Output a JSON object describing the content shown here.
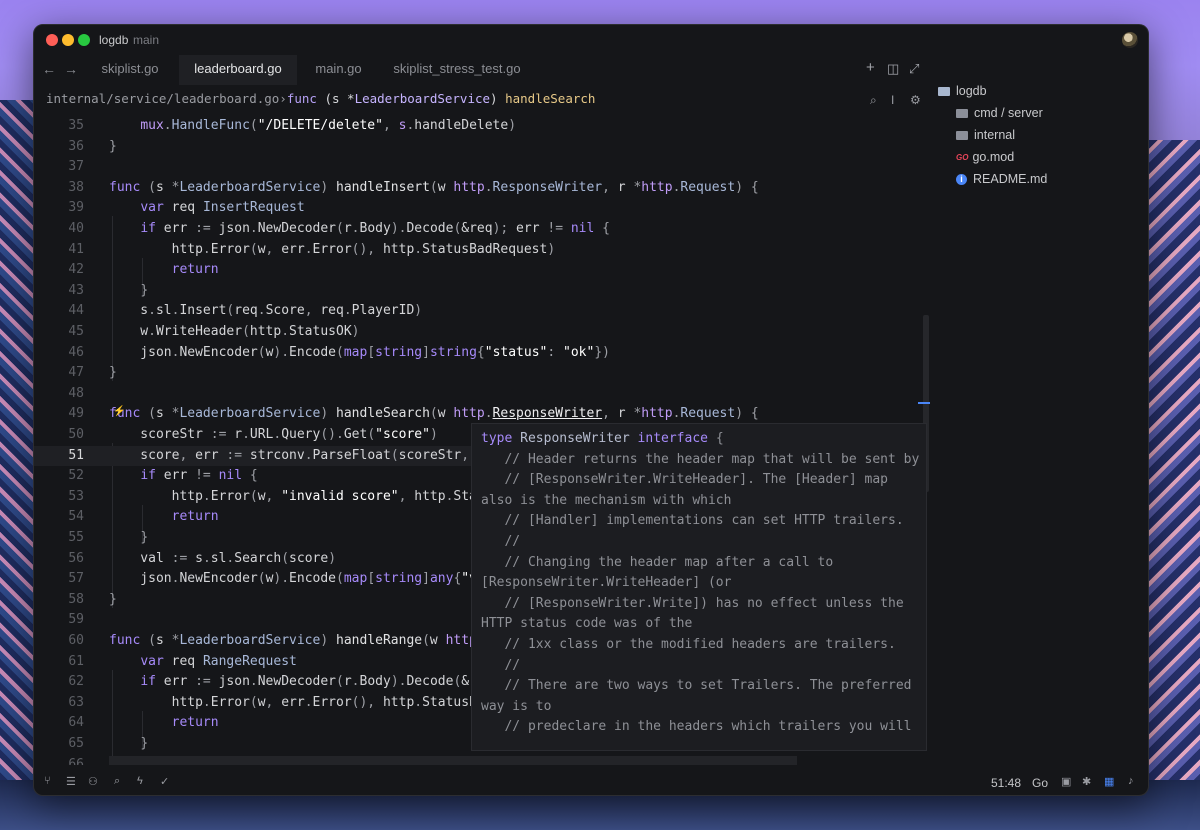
{
  "window": {
    "project": "logdb",
    "branch": "main"
  },
  "nav": {
    "back": "←",
    "forward": "→"
  },
  "tabs": [
    {
      "label": "skiplist.go",
      "active": false
    },
    {
      "label": "leaderboard.go",
      "active": true
    },
    {
      "label": "main.go",
      "active": false
    },
    {
      "label": "skiplist_stress_test.go",
      "active": false
    }
  ],
  "tab_actions": {
    "new": "+",
    "split": "◫",
    "zoom": "⤢"
  },
  "breadcrumb": {
    "path": "internal/service/leaderboard.go",
    "sep": "›",
    "func": "func",
    "recv_open": " (s *",
    "recv_type": "LeaderboardService",
    "recv_close": ") ",
    "name": "handleSearch"
  },
  "breadcrumb_tools": {
    "search": "⌕",
    "cursor": "I",
    "settings": "⚙"
  },
  "line_numbers": [
    "35",
    "36",
    "37",
    "38",
    "39",
    "40",
    "41",
    "42",
    "43",
    "44",
    "45",
    "46",
    "47",
    "48",
    "49",
    "50",
    "51",
    "52",
    "53",
    "54",
    "55",
    "56",
    "57",
    "58",
    "59",
    "60",
    "61",
    "62",
    "63",
    "64",
    "65",
    "66"
  ],
  "current_line": "51",
  "gutter_marker": "⚡",
  "tooltip": [
    "type ResponseWriter interface {",
    "   // Header returns the header map that will be sent by",
    "   // [ResponseWriter.WriteHeader]. The [Header] map",
    "also is the mechanism with which",
    "   // [Handler] implementations can set HTTP trailers.",
    "   //",
    "   // Changing the header map after a call to",
    "[ResponseWriter.WriteHeader] (or",
    "   // [ResponseWriter.Write]) has no effect unless the",
    "HTTP status code was of the",
    "   // 1xx class or the modified headers are trailers.",
    "   //",
    "   // There are two ways to set Trailers. The preferred",
    "way is to",
    "   // predeclare in the headers which trailers you will"
  ],
  "sidebar": {
    "root": "logdb",
    "items": [
      {
        "label": "cmd / server",
        "kind": "folder"
      },
      {
        "label": "internal",
        "kind": "folder"
      },
      {
        "label": "go.mod",
        "kind": "go"
      },
      {
        "label": "README.md",
        "kind": "info"
      }
    ],
    "go_badge": "GO",
    "info_badge": "i"
  },
  "status": {
    "position": "51:48",
    "language": "Go"
  },
  "colors": {
    "accent": "#4a86f7",
    "keyword": "#a68af9",
    "background": "#151619"
  }
}
